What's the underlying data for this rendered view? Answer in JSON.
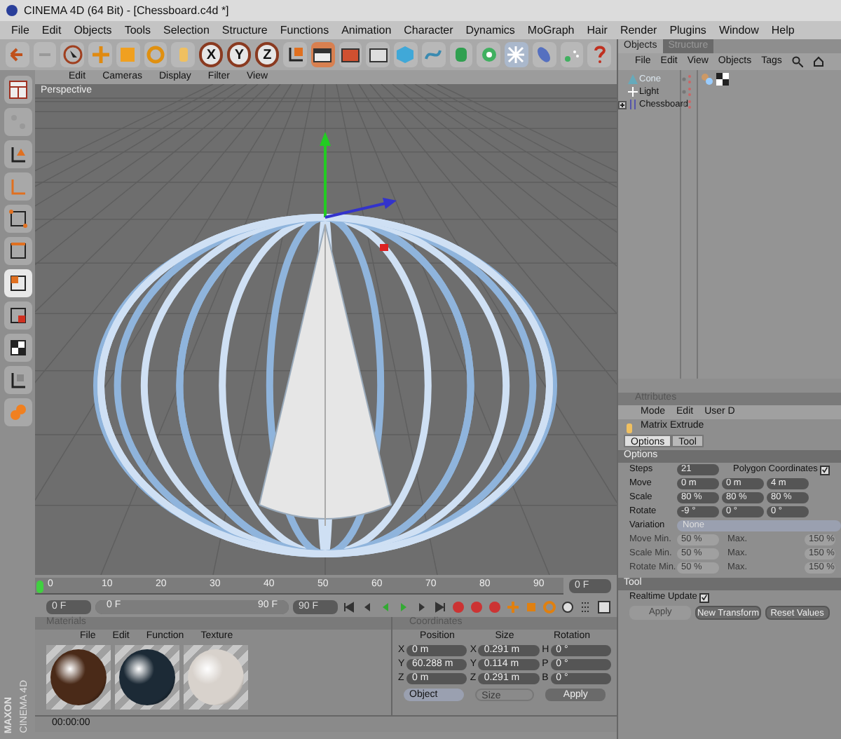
{
  "window": {
    "title": "CINEMA 4D (64 Bit) - [Chessboard.c4d *]"
  },
  "menu": [
    "File",
    "Edit",
    "Objects",
    "Tools",
    "Selection",
    "Structure",
    "Functions",
    "Animation",
    "Character",
    "Dynamics",
    "MoGraph",
    "Hair",
    "Render",
    "Plugins",
    "Window",
    "Help"
  ],
  "axis_buttons": [
    "X",
    "Y",
    "Z"
  ],
  "viewport": {
    "menu": [
      "Edit",
      "Cameras",
      "Display",
      "Filter",
      "View"
    ],
    "label": "Perspective"
  },
  "object_manager": {
    "tabs": [
      {
        "label": "Objects",
        "selected": true
      },
      {
        "label": "Structure",
        "selected": false
      }
    ],
    "menu": [
      "File",
      "Edit",
      "View",
      "Objects",
      "Tags"
    ],
    "objects": [
      {
        "name": "Cone",
        "expandable": false
      },
      {
        "name": "Light",
        "expandable": false
      },
      {
        "name": "Chessboard",
        "expandable": true
      }
    ]
  },
  "attributes": {
    "title": "Attributes",
    "menu": [
      "Mode",
      "Edit",
      "User D"
    ],
    "tool": "Matrix Extrude",
    "tabs": [
      {
        "label": "Options",
        "selected": true
      },
      {
        "label": "Tool",
        "selected": false
      }
    ],
    "options_heading": "Options",
    "steps": {
      "label": "Steps",
      "value": "21"
    },
    "polygon_coordinates": {
      "label": "Polygon Coordinates",
      "checked": true
    },
    "vector_rows": [
      {
        "label": "Move",
        "values": [
          "0 m",
          "0 m",
          "4 m"
        ]
      },
      {
        "label": "Scale",
        "values": [
          "80 %",
          "80 %",
          "80 %"
        ]
      },
      {
        "label": "Rotate",
        "values": [
          "-9 °",
          "0 °",
          "0 °"
        ]
      }
    ],
    "variation": {
      "label": "Variation",
      "value": "None"
    },
    "min_max_rows": [
      {
        "label": "Move Min.",
        "min": "50 %",
        "max_label": "Max.",
        "max": "150 %",
        "disabled": true
      },
      {
        "label": "Scale Min.",
        "min": "50 %",
        "max_label": "Max.",
        "max": "150 %",
        "disabled": true
      },
      {
        "label": "Rotate Min.",
        "min": "50 %",
        "max_label": "Max.",
        "max": "150 %",
        "disabled": true
      }
    ],
    "tool_heading": "Tool",
    "realtime_update": {
      "label": "Realtime Update",
      "checked": true
    },
    "buttons": [
      {
        "label": "Apply",
        "disabled": true
      },
      {
        "label": "New Transform",
        "disabled": false
      },
      {
        "label": "Reset Values",
        "disabled": false
      }
    ]
  },
  "timeline": {
    "ruler_labels": [
      "0",
      "10",
      "20",
      "30",
      "40",
      "50",
      "60",
      "70",
      "80",
      "90"
    ],
    "playhead": {
      "level": 0
    },
    "range_bar": {
      "level": 1
    },
    "current_frame": "0 F",
    "start_field": "0 F",
    "range_start": "0 F",
    "range_end": "90 F",
    "end_field": "90 F"
  },
  "materials": {
    "title": "Materials",
    "menu": [
      "File",
      "Edit",
      "Function",
      "Texture"
    ],
    "swatches": [
      {
        "color": "#4a2a18"
      },
      {
        "color": "#1c2a36"
      },
      {
        "color": "#d8d2cc"
      }
    ]
  },
  "coordinates": {
    "title": "Coordinates",
    "headers": [
      "Position",
      "Size",
      "Rotation"
    ],
    "rows": [
      {
        "cells": [
          {
            "axis": "X",
            "value": "0 m"
          },
          {
            "axis": "X",
            "value": "0.291 m"
          },
          {
            "axis": "H",
            "value": "0 °"
          }
        ]
      },
      {
        "cells": [
          {
            "axis": "Y",
            "value": "60.288 m"
          },
          {
            "axis": "Y",
            "value": "0.114 m"
          },
          {
            "axis": "P",
            "value": "0 °"
          }
        ]
      },
      {
        "cells": [
          {
            "axis": "Z",
            "value": "0 m"
          },
          {
            "axis": "Z",
            "value": "0.291 m"
          },
          {
            "axis": "B",
            "value": "0 °"
          }
        ]
      }
    ],
    "mode_dropdown": {
      "value": "Object",
      "disabled": false
    },
    "size_dropdown": {
      "value": "Size",
      "disabled": true
    },
    "apply": "Apply"
  },
  "logo": {
    "brand": "MAXON",
    "product": "CINEMA 4D"
  },
  "status_bar": {
    "time": "00:00:00"
  }
}
